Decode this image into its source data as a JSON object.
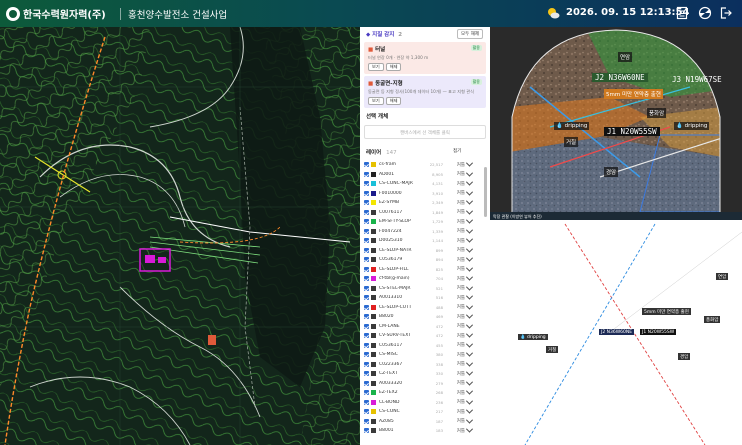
{
  "header": {
    "company": "한국수력원자력(주)",
    "project": "홍천양수발전소 건설사업",
    "datetime": "2026. 09. 15  12:13:54",
    "weather_icon": "partly-cloudy-icon",
    "icons": [
      "report-icon",
      "settings-dial-icon",
      "logout-icon"
    ]
  },
  "panel": {
    "title": "◆ 지질 감지",
    "count": "2",
    "clear_all": "모두 해제",
    "cards": [
      {
        "title": "터널",
        "badge": "활용",
        "sub": "터널 연장 0개 · 연장 약 1,300 m",
        "btn1": "보기",
        "btn2": "해제",
        "bg": "#fbe9e6",
        "dot": "#e05a3a"
      },
      {
        "title": "동굴면-지형",
        "badge": "활용",
        "sub": "동굴면 등 지형 정사(100개 데이터 10개) — 표고 지형 관식",
        "btn1": "보기",
        "btn2": "해제",
        "bg": "#ece9fb",
        "dot": "#6a4ad2"
      }
    ],
    "selection_title": "선택 개체",
    "selection_hint": "캔버스에서 선 객체를 클릭",
    "layers_title": "레이어",
    "layers_count": "147",
    "layers_toggle": "접기",
    "layer_type_label": "커틀",
    "layers": [
      {
        "name": "cs-fram",
        "count": "22,517",
        "color": "#e6c100"
      },
      {
        "name": "AD001",
        "count": "8,905",
        "color": "#222222"
      },
      {
        "name": "CS-CONC-MAJR",
        "count": "4,131",
        "color": "#19c0d9"
      },
      {
        "name": "F0010000",
        "count": "3,910",
        "color": "#1b1b8c"
      },
      {
        "name": "EZ-SYMB",
        "count": "2,349",
        "color": "#f3e600"
      },
      {
        "name": "C0076117",
        "count": "1,849",
        "color": "#3a3a3a"
      },
      {
        "name": "EM-SFTY-SLOP",
        "count": "1,729",
        "color": "#19b34a"
      },
      {
        "name": "F0047224",
        "count": "1,339",
        "color": "#3a3a3a"
      },
      {
        "name": "D0025310",
        "count": "1,144",
        "color": "#3a3a3a"
      },
      {
        "name": "CE-SLOP-NATR",
        "count": "899",
        "color": "#3a3a3a"
      },
      {
        "name": "C0536179",
        "count": "894",
        "color": "#3a3a3a"
      },
      {
        "name": "CE-SLOP-FILL",
        "count": "825",
        "color": "#e02020"
      },
      {
        "name": "cf-tbl(g-main)",
        "count": "704",
        "color": "#d81ad8"
      },
      {
        "name": "CS-STEL-MAJR",
        "count": "521",
        "color": "#3a3a3a"
      },
      {
        "name": "A0013310",
        "count": "516",
        "color": "#3a3a3a"
      },
      {
        "name": "CE-SLOP-CUTT",
        "count": "488",
        "color": "#e02020"
      },
      {
        "name": "B8020",
        "count": "469",
        "color": "#3a3a3a"
      },
      {
        "name": "CM-LANE",
        "count": "472",
        "color": "#3a3a3a"
      },
      {
        "name": "CV-SURV-TEXT",
        "count": "472",
        "color": "#3a3a3a"
      },
      {
        "name": "C0536117",
        "count": "455",
        "color": "#3a3a3a"
      },
      {
        "name": "CS-MISC",
        "count": "380",
        "color": "#3a3a3a"
      },
      {
        "name": "C0223367",
        "count": "338",
        "color": "#3a3a3a"
      },
      {
        "name": "CZ-TEXT",
        "count": "330",
        "color": "#3a3a3a"
      },
      {
        "name": "A0033320",
        "count": "279",
        "color": "#3a3a3a"
      },
      {
        "name": "EZ-TEX2",
        "count": "268",
        "color": "#19b34a"
      },
      {
        "name": "CL-BOND",
        "count": "236",
        "color": "#d81ad8"
      },
      {
        "name": "CS-CONC",
        "count": "217",
        "color": "#e6c100"
      },
      {
        "name": "AZ085",
        "count": "187",
        "color": "#3a3a3a"
      },
      {
        "name": "B8001",
        "count": "183",
        "color": "#3a3a3a"
      }
    ]
  },
  "photo": {
    "labels": {
      "top": "연암",
      "j2": "J2 N36W60NE",
      "j3": "J3 N19W67SE",
      "zone": "5mm 미만 연약층 출현",
      "weathered": "풍화암",
      "drip_left": "💧 dripping",
      "drip_right": "💧 dripping",
      "j1": "J1 N20W55SW",
      "hard": "경암",
      "rock": "거칠"
    }
  },
  "sketch": {
    "header": "막장 관찰 (이방연 뷰어 추진)",
    "labels": {
      "top": "연암",
      "zone": "5mm 미만 연약층 출현",
      "weathered": "풍화암",
      "drip": "💧 dripping",
      "j2": "J2 N36W60NE",
      "j1": "J1 N20W55SW",
      "rock": "거칠",
      "hard": "경암"
    }
  }
}
